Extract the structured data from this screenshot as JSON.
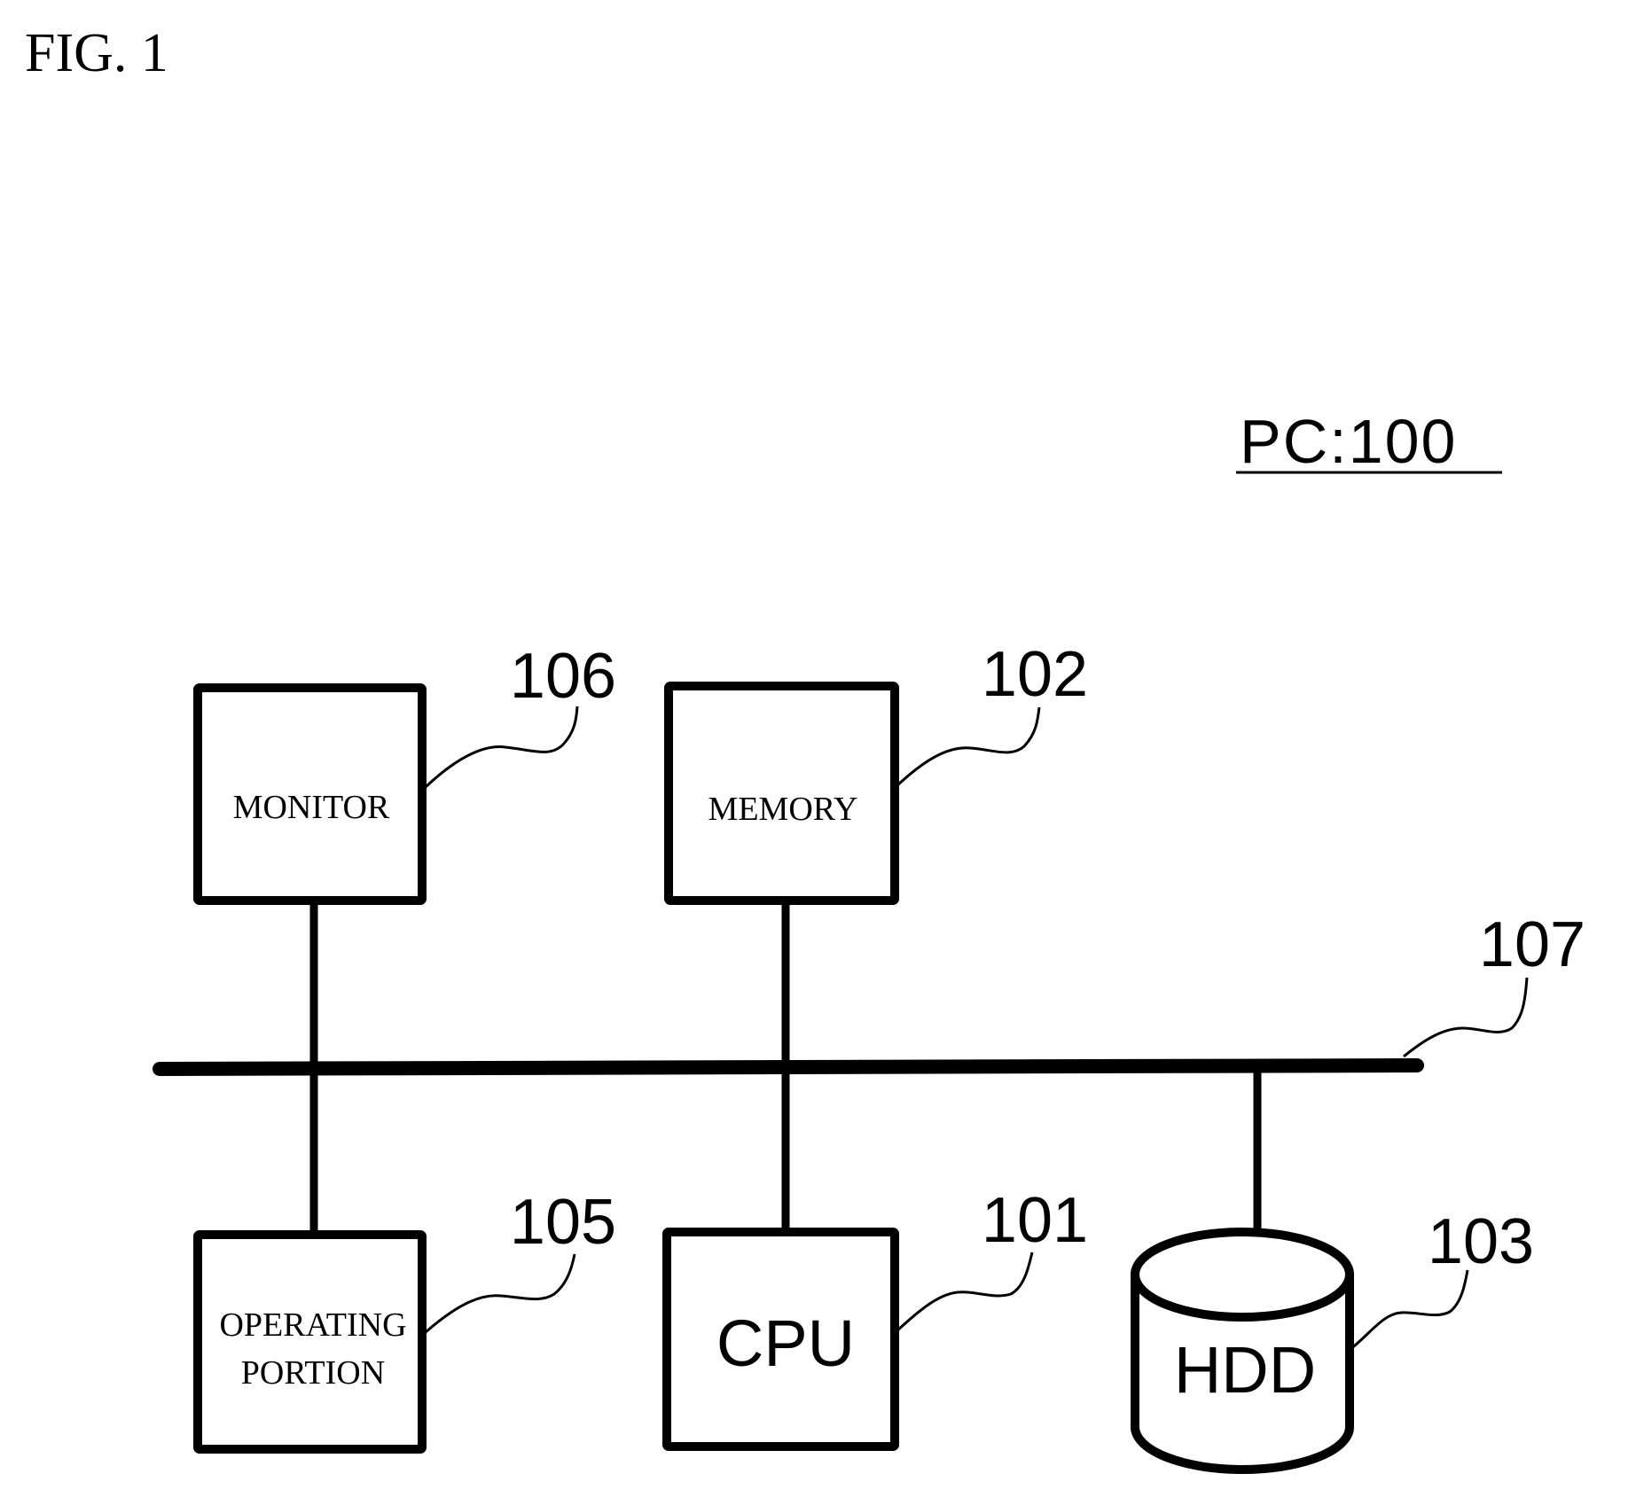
{
  "figure": {
    "title": "FIG. 1",
    "system_label": "PC:100"
  },
  "components": {
    "monitor": {
      "label": "MONITOR",
      "ref": "106"
    },
    "memory": {
      "label": "MEMORY",
      "ref": "102"
    },
    "operating_portion": {
      "label_line1": "OPERATING",
      "label_line2": "PORTION",
      "ref": "105"
    },
    "cpu": {
      "label": "CPU",
      "ref": "101"
    },
    "hdd": {
      "label": "HDD",
      "ref": "103"
    },
    "bus": {
      "ref": "107"
    }
  },
  "colors": {
    "ink": "#000000",
    "paper": "#ffffff"
  }
}
